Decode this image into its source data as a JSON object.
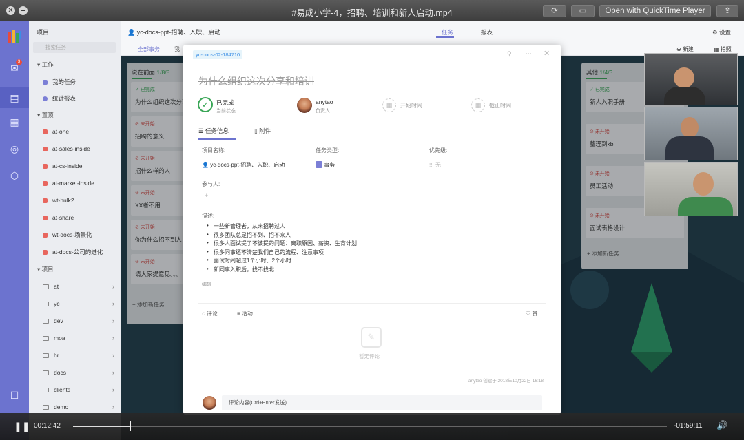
{
  "window": {
    "title": "#易成小学-4，招聘、培训和新人启动.mp4",
    "open_with_label": "Open with QuickTime Player"
  },
  "sidebar": {
    "header": "项目",
    "search_placeholder": "搜索任务",
    "groups": {
      "work": "工作",
      "shortcuts": "置顶",
      "projects": "项目"
    },
    "work_items": [
      "我的任务",
      "统计报表"
    ],
    "pinned_items": [
      "at-one",
      "at-sales-inside",
      "at-cs-inside",
      "at-market-inside",
      "wt-hulk2",
      "at-share",
      "wt-docs-场景化",
      "at-docs-公司的进化"
    ],
    "pinned_colors": [
      "#e8665e",
      "#e8665e",
      "#e8665e",
      "#e8665e",
      "#e8665e",
      "#e8665e",
      "#e8665e",
      "#e8665e"
    ],
    "project_folders": [
      "at",
      "yc",
      "dev",
      "moa",
      "hr",
      "docs",
      "clients",
      "demo"
    ]
  },
  "topbar": {
    "project_title": "yc-docs-ppt-招聘、入职、启动",
    "tabs": [
      "任务",
      "报表"
    ],
    "settings_label": "设置",
    "filter_all": "全部事务",
    "filter_more": "我",
    "new_label": "新建",
    "more_label": "拍照"
  },
  "board": {
    "columns": [
      {
        "name": "说在前面",
        "count": "1/8/8",
        "cards": [
          {
            "status": "已完成",
            "title": "为什么组织这次分享和..."
          },
          {
            "status": "未开始",
            "title": "招聘的意义"
          },
          {
            "status": "未开始",
            "title": "招什么样的人"
          },
          {
            "status": "未开始",
            "title": "XX者不用"
          },
          {
            "status": "未开始",
            "title": "你为什么招不到人"
          },
          {
            "status": "未开始",
            "title": "请大家提意见。。。"
          }
        ],
        "add_label": "添加新任务"
      },
      {
        "name": "其他",
        "count": "1/4/3",
        "cards": [
          {
            "status": "已完成",
            "title": "新人入职手册"
          },
          {
            "status": "未开始",
            "title": "整理到kb"
          },
          {
            "status": "未开始",
            "title": "员工活动"
          },
          {
            "status": "未开始",
            "title": "面试表格设计"
          }
        ],
        "add_label": "添加新任务"
      }
    ]
  },
  "modal": {
    "task_id": "yc-docs-02-184710",
    "title": "为什么组织这次分享和培训",
    "status_label": "已完成",
    "status_sub": "当前状态",
    "assignee_name": "anytao",
    "assignee_sub": "负责人",
    "start_label": "开始时间",
    "due_label": "截止时间",
    "tabs": [
      "任务信息",
      "附件"
    ],
    "project_name_label": "项目名称:",
    "project_name_value": "yc-docs-ppt-招聘、入职、启动",
    "task_type_label": "任务类型:",
    "task_type_value": "事务",
    "priority_label": "优先级:",
    "priority_value": "无",
    "participants_label": "参与人:",
    "description_label": "描述:",
    "description_items": [
      "一些新管理者，从未招聘过人",
      "很多团队总是招不到、招不来人",
      "很多人面试提了不该提的问题：离职原因、薪资、生育计划",
      "很多同事还不清楚我们自己的流程、注意事项",
      "面试时间超过1个小时、2个小时",
      "新同事入职后，找不找北"
    ],
    "edit_label": "编辑",
    "comment_tab": "评论",
    "activity_tab": "活动",
    "like_label": "赞",
    "empty_comment": "暂无评论",
    "created_info": "anytao 创建于 2018年10月22日 16:18",
    "comment_placeholder": "评论内容(Ctrl+Enter发送)"
  },
  "player": {
    "elapsed": "00:12:42",
    "remaining": "-01:59:11",
    "progress": 0.096
  },
  "colors": {
    "rail": "#6c73cf",
    "accent": "#3a8ee6",
    "done": "#3aa657",
    "todo": "#d9534f"
  }
}
